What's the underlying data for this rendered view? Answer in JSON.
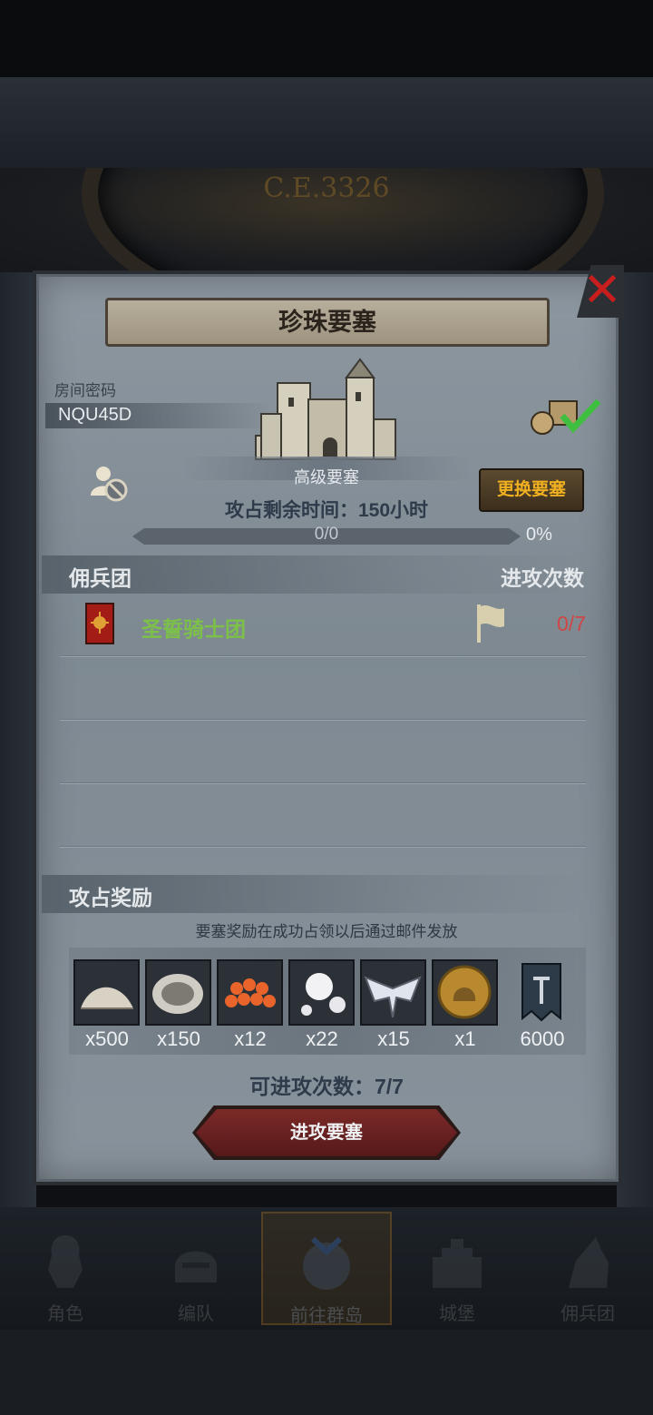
{
  "background": {
    "year": "C.E.3326"
  },
  "dialog": {
    "title": "珍珠要塞",
    "room_code_label": "房间密码",
    "room_code": "NQU45D",
    "fortress_level": "高级要塞",
    "swap_button": "更换要塞",
    "time_remaining": "攻占剩余时间：150小时",
    "progress": {
      "text": "0/0",
      "percent_label": "0%",
      "fraction": 0
    },
    "mercenary_header": "佣兵团",
    "attack_count_header": "进攻次数",
    "mercenaries": [
      {
        "name": "圣誓骑士团",
        "attacks": "0/7"
      }
    ],
    "rewards_header": "攻占奖励",
    "rewards_note": "要塞奖励在成功占领以后通过邮件发放",
    "rewards": [
      {
        "icon": "sand-pile-icon",
        "qty": "x500"
      },
      {
        "icon": "oyster-icon",
        "qty": "x150"
      },
      {
        "icon": "fish-roe-icon",
        "qty": "x12"
      },
      {
        "icon": "pearls-icon",
        "qty": "x22"
      },
      {
        "icon": "bat-wing-emblem-icon",
        "qty": "x15"
      },
      {
        "icon": "knight-helmet-coin-icon",
        "qty": "x1"
      },
      {
        "icon": "guild-banner-icon",
        "qty": "6000"
      }
    ],
    "attacks_available": "可进攻次数：7/7",
    "attack_button": "进攻要塞"
  },
  "bottom_nav": [
    {
      "label": "角色",
      "active": false
    },
    {
      "label": "编队",
      "active": false
    },
    {
      "label": "前往群岛",
      "active": true
    },
    {
      "label": "城堡",
      "active": false
    },
    {
      "label": "佣兵团",
      "active": false
    }
  ],
  "colors": {
    "panel": "#848e97",
    "accent_gold": "#f0b020",
    "mercenary_green": "#7cc04a",
    "attack_red": "#d04545",
    "close_red": "#c81e1e"
  }
}
